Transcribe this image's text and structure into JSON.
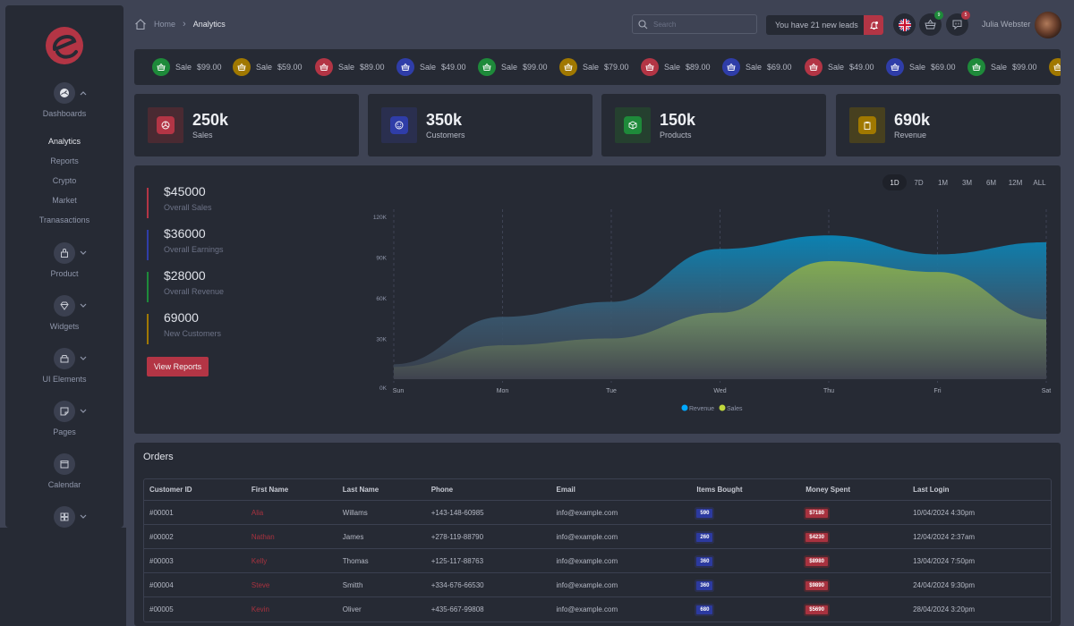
{
  "sidebar": {
    "brand_color": "#b33545",
    "groups": [
      {
        "label": "Dashboards",
        "icon": "gauge-icon",
        "expanded": true
      },
      {
        "label": "Product",
        "icon": "shopping-bag-icon",
        "expanded": false
      },
      {
        "label": "Widgets",
        "icon": "diamond-icon",
        "expanded": false
      },
      {
        "label": "UI Elements",
        "icon": "box-icon",
        "expanded": false
      },
      {
        "label": "Pages",
        "icon": "sticky-note-icon",
        "expanded": false
      },
      {
        "label": "Calendar",
        "icon": "calendar-icon",
        "expanded": false
      },
      {
        "label": "",
        "icon": "layout-icon",
        "expanded": false
      }
    ],
    "dashboard_items": [
      {
        "label": "Analytics",
        "active": true
      },
      {
        "label": "Reports",
        "active": false
      },
      {
        "label": "Crypto",
        "active": false
      },
      {
        "label": "Market",
        "active": false
      },
      {
        "label": "Tranasactions",
        "active": false
      }
    ]
  },
  "header": {
    "breadcrumb": {
      "home": "Home",
      "current": "Analytics"
    },
    "search_placeholder": "Search",
    "leads_text": "You have 21 new leads",
    "cart_badge": "9",
    "messages_badge": "5",
    "user_name": "Julia Webster"
  },
  "ticker": [
    {
      "label": "Sale",
      "amount": "$99.00",
      "color": "#1e8a3a"
    },
    {
      "label": "Sale",
      "amount": "$59.00",
      "color": "#a07800"
    },
    {
      "label": "Sale",
      "amount": "$89.00",
      "color": "#b33545"
    },
    {
      "label": "Sale",
      "amount": "$49.00",
      "color": "#2f3da8"
    },
    {
      "label": "Sale",
      "amount": "$99.00",
      "color": "#1e8a3a"
    },
    {
      "label": "Sale",
      "amount": "$79.00",
      "color": "#a07800"
    },
    {
      "label": "Sale",
      "amount": "$89.00",
      "color": "#b33545"
    },
    {
      "label": "Sale",
      "amount": "$69.00",
      "color": "#2f3da8"
    },
    {
      "label": "Sale",
      "amount": "$49.00",
      "color": "#b33545"
    },
    {
      "label": "Sale",
      "amount": "$69.00",
      "color": "#2f3da8"
    },
    {
      "label": "Sale",
      "amount": "$99.00",
      "color": "#1e8a3a"
    },
    {
      "label": "",
      "amount": "",
      "color": "#a07800"
    }
  ],
  "stats": [
    {
      "value": "250k",
      "caption": "Sales",
      "icon": "chart-pie-icon",
      "color": "#b33545",
      "tint": "#4a2a32"
    },
    {
      "value": "350k",
      "caption": "Customers",
      "icon": "smiley-icon",
      "color": "#2f3da8",
      "tint": "#2a2f4f"
    },
    {
      "value": "150k",
      "caption": "Products",
      "icon": "cube-icon",
      "color": "#1e8a3a",
      "tint": "#25402f"
    },
    {
      "value": "690k",
      "caption": "Revenue",
      "icon": "clipboard-icon",
      "color": "#a07800",
      "tint": "#47401f"
    }
  ],
  "kpis": [
    {
      "value": "$45000",
      "caption": "Overall Sales",
      "color": "#b33545"
    },
    {
      "value": "$36000",
      "caption": "Overall Earnings",
      "color": "#2f3da8"
    },
    {
      "value": "$28000",
      "caption": "Overall Revenue",
      "color": "#1e8a3a"
    },
    {
      "value": "69000",
      "caption": "New Customers",
      "color": "#a07800"
    }
  ],
  "view_reports_label": "View Reports",
  "ranges": [
    {
      "label": "1D",
      "active": true
    },
    {
      "label": "7D",
      "active": false
    },
    {
      "label": "1M",
      "active": false
    },
    {
      "label": "3M",
      "active": false
    },
    {
      "label": "6M",
      "active": false
    },
    {
      "label": "12M",
      "active": false
    },
    {
      "label": "ALL",
      "active": false
    }
  ],
  "chart_data": {
    "type": "area",
    "title": "",
    "xlabel": "",
    "ylabel": "",
    "x": [
      "Sun",
      "Mon",
      "Tue",
      "Wed",
      "Thu",
      "Fri",
      "Sat"
    ],
    "series": [
      {
        "name": "Revenue",
        "color": "#00a8ff",
        "values": [
          11000,
          46000,
          57000,
          96000,
          106000,
          92000,
          101000
        ]
      },
      {
        "name": "Sales",
        "color": "#c0d83c",
        "values": [
          9000,
          25000,
          30000,
          49000,
          87000,
          79000,
          44000
        ]
      }
    ],
    "ylim": [
      0,
      120000
    ],
    "yticks": [
      "0K",
      "30K",
      "60K",
      "90K",
      "120K"
    ],
    "grid": "vertical-dashed",
    "legend": "bottom-center"
  },
  "orders": {
    "title": "Orders",
    "columns": [
      "Customer ID",
      "First Name",
      "Last Name",
      "Phone",
      "Email",
      "Items Bought",
      "Money Spent",
      "Last Login"
    ],
    "rows": [
      [
        "#00001",
        "Alia",
        "Willams",
        "+143-148-60985",
        "info@example.com",
        "590",
        "$7180",
        "10/04/2024 4:30pm"
      ],
      [
        "#00002",
        "Nathan",
        "James",
        "+278-119-88790",
        "info@example.com",
        "260",
        "$4230",
        "12/04/2024 2:37am"
      ],
      [
        "#00003",
        "Kelly",
        "Thomas",
        "+125-117-88763",
        "info@example.com",
        "360",
        "$8980",
        "13/04/2024 7:50pm"
      ],
      [
        "#00004",
        "Steve",
        "Smitth",
        "+334-676-66530",
        "info@example.com",
        "360",
        "$9890",
        "24/04/2024 9:30pm"
      ],
      [
        "#00005",
        "Kevin",
        "Oliver",
        "+435-667-99808",
        "info@example.com",
        "680",
        "$5690",
        "28/04/2024 3:20pm"
      ]
    ]
  }
}
